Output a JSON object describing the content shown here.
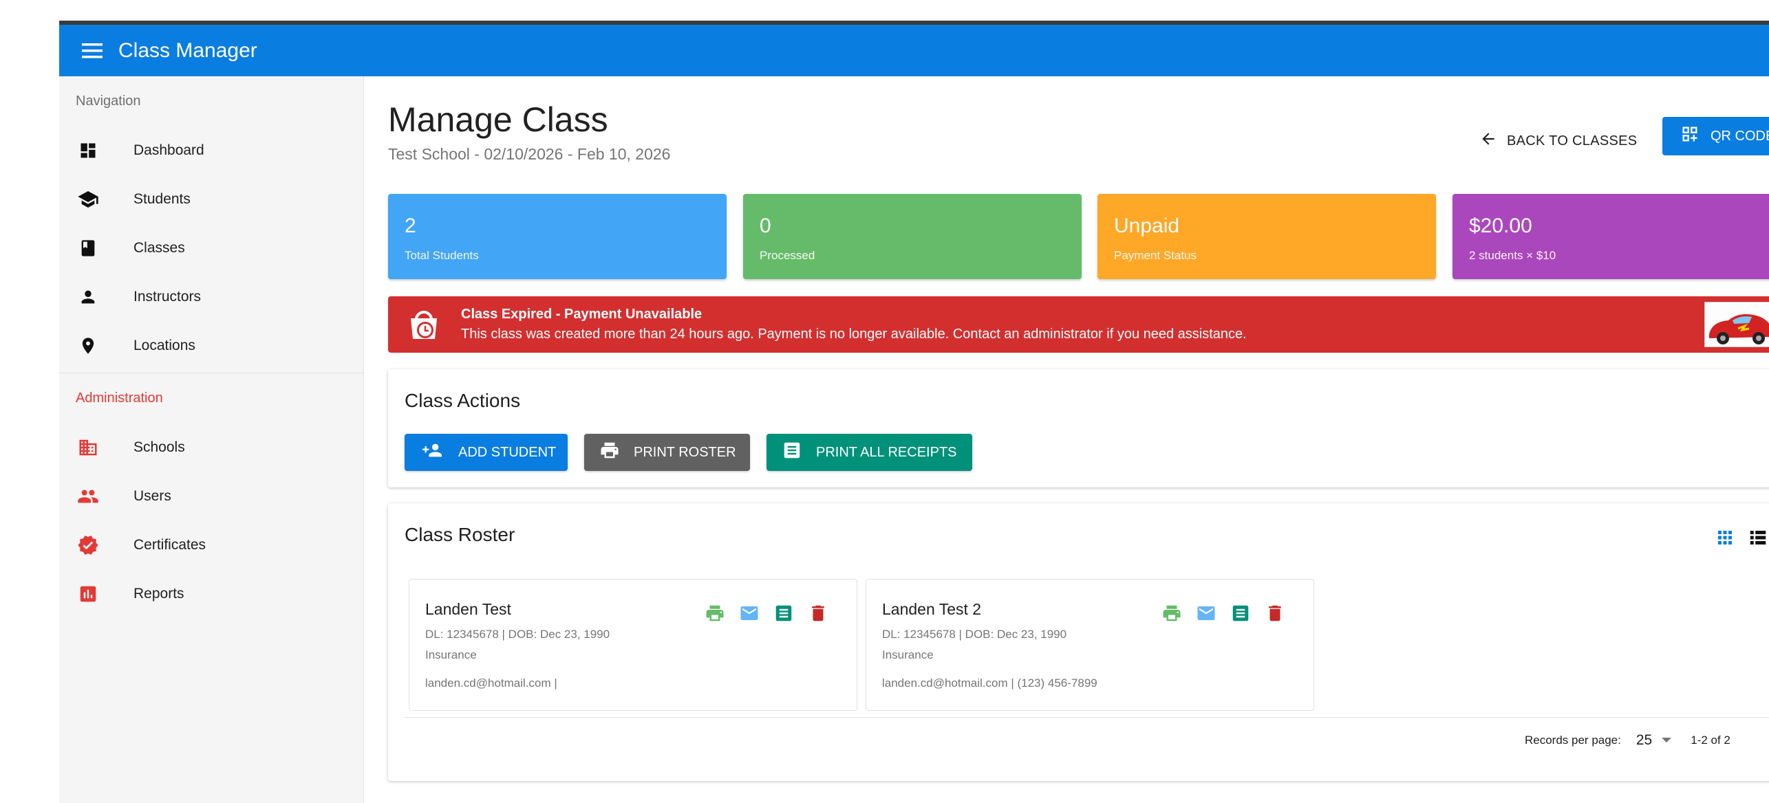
{
  "app": {
    "title": "Class Manager"
  },
  "sidebar": {
    "nav_header": "Navigation",
    "nav_items": [
      {
        "label": "Dashboard",
        "icon": "dashboard-icon"
      },
      {
        "label": "Students",
        "icon": "school-icon"
      },
      {
        "label": "Classes",
        "icon": "book-icon"
      },
      {
        "label": "Instructors",
        "icon": "person-icon"
      },
      {
        "label": "Locations",
        "icon": "location-pin-icon"
      }
    ],
    "admin_header": "Administration",
    "admin_items": [
      {
        "label": "Schools",
        "icon": "building-icon"
      },
      {
        "label": "Users",
        "icon": "people-icon"
      },
      {
        "label": "Certificates",
        "icon": "verified-badge-icon"
      },
      {
        "label": "Reports",
        "icon": "bar-chart-icon"
      }
    ]
  },
  "header": {
    "title": "Manage Class",
    "subtitle": "Test School - 02/10/2026 - Feb 10, 2026",
    "back_label": "BACK TO CLASSES",
    "qr_label": "QR CODE"
  },
  "stats": [
    {
      "value": "2",
      "label": "Total Students",
      "color": "#42a5f5"
    },
    {
      "value": "0",
      "label": "Processed",
      "color": "#66bb6a"
    },
    {
      "value": "Unpaid",
      "label": "Payment Status",
      "color": "#ffa726"
    },
    {
      "value": "$20.00",
      "label": "2 students × $10",
      "color": "#ab47bc"
    }
  ],
  "alert": {
    "title": "Class Expired - Payment Unavailable",
    "message": "This class was created more than 24 hours ago. Payment is no longer available. Contact an administrator if you need assistance.",
    "color": "#d32f2f"
  },
  "actions": {
    "title": "Class Actions",
    "add_student": "ADD STUDENT",
    "print_roster": "PRINT ROSTER",
    "print_receipts": "PRINT ALL RECEIPTS"
  },
  "roster": {
    "title": "Class Roster",
    "students": [
      {
        "name": "Landen Test",
        "details": "DL: 12345678 | DOB: Dec 23, 1990",
        "type": "Insurance",
        "contact": "landen.cd@hotmail.com |"
      },
      {
        "name": "Landen Test 2",
        "details": "DL: 12345678 | DOB: Dec 23, 1990",
        "type": "Insurance",
        "contact": "landen.cd@hotmail.com | (123) 456-7899"
      }
    ],
    "records_label": "Records per page:",
    "records_value": "25",
    "range": "1-2 of 2"
  }
}
